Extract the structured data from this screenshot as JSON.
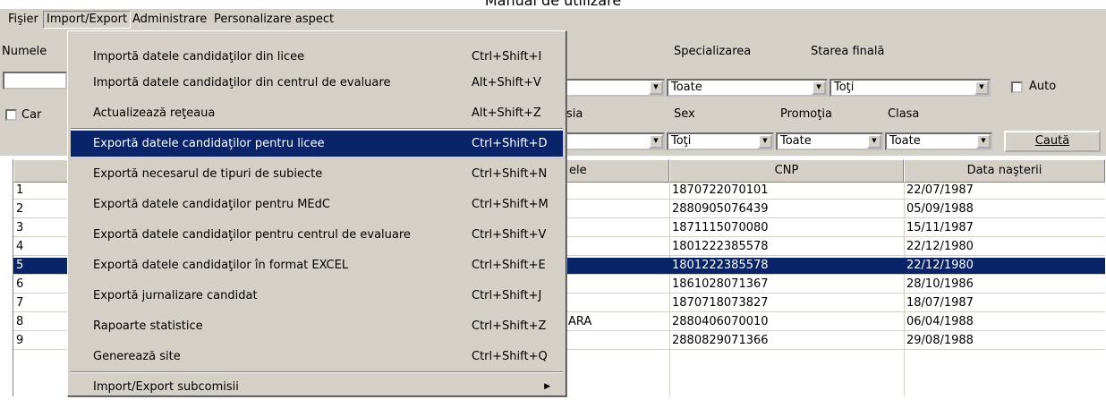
{
  "doc": {
    "title": "Manual de utilizare"
  },
  "menubar": [
    "Fişier",
    "Import/Export",
    "Administrare",
    "Personalizare aspect"
  ],
  "filters": {
    "numele_label": "Numele",
    "specializarea_label": "Specializarea",
    "specializarea_value": "Toate",
    "starea_label": "Starea finală",
    "starea_value": "Toţi",
    "auto_label": "Auto",
    "car_label": "Car",
    "sia_label": "sia",
    "sex_label": "Sex",
    "sex_value": "Toţi",
    "promotia_label": "Promoţia",
    "promotia_value": "Toate",
    "clasa_label": "Clasa",
    "clasa_value": "Toate",
    "search_button": "Caută"
  },
  "table": {
    "headers": {
      "first": "",
      "nume_partial": "ele",
      "cnp": "CNP",
      "data": "Data naşterii"
    },
    "rows": [
      {
        "nr": "1",
        "name_tail": "",
        "cnp": "1870722070101",
        "date": "22/07/1987",
        "selected": false
      },
      {
        "nr": "2",
        "name_tail": "",
        "cnp": "2880905076439",
        "date": "05/09/1988",
        "selected": false
      },
      {
        "nr": "3",
        "name_tail": "",
        "cnp": "1871115070080",
        "date": "15/11/1987",
        "selected": false
      },
      {
        "nr": "4",
        "name_tail": "",
        "cnp": "1801222385578",
        "date": "22/12/1980",
        "selected": false
      },
      {
        "nr": "5",
        "name_tail": "",
        "cnp": "1801222385578",
        "date": "22/12/1980",
        "selected": true
      },
      {
        "nr": "6",
        "name_tail": "",
        "cnp": "1861028071367",
        "date": "28/10/1986",
        "selected": false
      },
      {
        "nr": "7",
        "name_tail": "",
        "cnp": "1870718073827",
        "date": "18/07/1987",
        "selected": false
      },
      {
        "nr": "8",
        "name_tail": "ARA",
        "cnp": "2880406070010",
        "date": "06/04/1988",
        "selected": false
      },
      {
        "nr": "9",
        "name_tail": "",
        "cnp": "2880829071366",
        "date": "29/08/1988",
        "selected": false
      }
    ]
  },
  "menu": {
    "items": [
      {
        "label": "Importă datele candidaţilor din licee",
        "shortcut": "Ctrl+Shift+I"
      },
      {
        "label": "Importă datele candidaţilor din centrul de evaluare",
        "shortcut": "Alt+Shift+V"
      },
      {
        "label": "Actualizează reţeaua",
        "shortcut": "Alt+Shift+Z"
      },
      {
        "label": "Exportă datele candidaţilor pentru licee",
        "shortcut": "Ctrl+Shift+D"
      },
      {
        "label": "Exportă necesarul de tipuri de subiecte",
        "shortcut": "Ctrl+Shift+N"
      },
      {
        "label": "Exportă datele candidaţilor pentru MEdC",
        "shortcut": "Ctrl+Shift+M"
      },
      {
        "label": "Exportă datele candidaţilor pentru centrul de evaluare",
        "shortcut": "Ctrl+Shift+V"
      },
      {
        "label": "Exportă datele candidaţilor în format EXCEL",
        "shortcut": "Ctrl+Shift+E"
      },
      {
        "label": "Exportă jurnalizare candidat",
        "shortcut": "Ctrl+Shift+J"
      },
      {
        "label": "Rapoarte statistice",
        "shortcut": "Ctrl+Shift+Z"
      },
      {
        "label": "Generează site",
        "shortcut": "Ctrl+Shift+Q"
      },
      {
        "label": "Import/Export subcomisii",
        "shortcut": ""
      }
    ],
    "highlighted_index": 3
  }
}
